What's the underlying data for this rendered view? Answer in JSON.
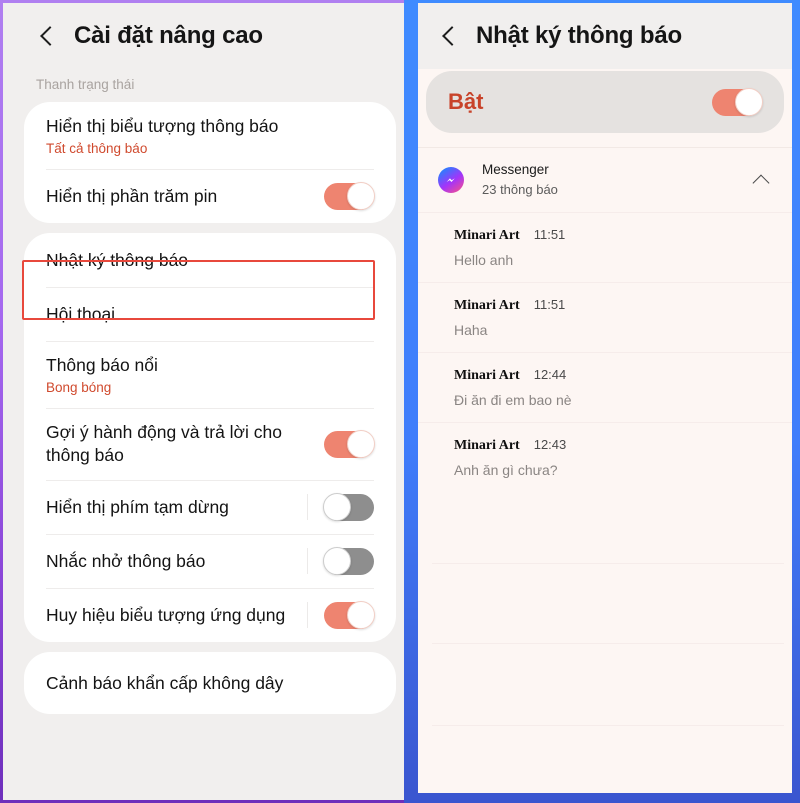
{
  "left_screen": {
    "header": {
      "back_icon": "back-chevron-icon",
      "title": "Cài đặt nâng cao"
    },
    "section_label": "Thanh trạng thái",
    "groups": [
      {
        "rows": [
          {
            "title": "Hiển thị biểu tượng thông báo",
            "subtitle": "Tất cả thông báo",
            "toggle": null
          },
          {
            "title": "Hiển thị phần trăm pin",
            "subtitle": "",
            "toggle": "on"
          }
        ]
      },
      {
        "rows": [
          {
            "title": "Nhật ký thông báo",
            "subtitle": "",
            "toggle": null,
            "highlighted": true
          },
          {
            "title": "Hội thoại",
            "subtitle": "",
            "toggle": null
          },
          {
            "title": "Thông báo nổi",
            "subtitle": "Bong bóng",
            "toggle": null
          },
          {
            "title": "Gợi ý hành động và trả lời cho thông báo",
            "subtitle": "",
            "toggle": "on"
          },
          {
            "title": "Hiển thị phím tạm dừng",
            "subtitle": "",
            "toggle": "off"
          },
          {
            "title": "Nhắc nhở thông báo",
            "subtitle": "",
            "toggle": "off"
          },
          {
            "title": "Huy hiệu biểu tượng ứng dụng",
            "subtitle": "",
            "toggle": "on"
          }
        ]
      },
      {
        "rows": [
          {
            "title": "Cảnh báo khẩn cấp không dây",
            "subtitle": "",
            "toggle": null
          }
        ]
      }
    ]
  },
  "right_screen": {
    "header": {
      "back_icon": "back-chevron-icon",
      "title": "Nhật ký thông báo"
    },
    "master_switch": {
      "label": "Bật",
      "state": "on"
    },
    "app_group": {
      "icon": "messenger-icon",
      "name": "Messenger",
      "count": "23 thông báo",
      "collapse_icon": "chevron-up-icon"
    },
    "notifications": [
      {
        "sender": "Minari Art",
        "time": "11:51",
        "body": "Hello anh"
      },
      {
        "sender": "Minari Art",
        "time": "11:51",
        "body": "Haha"
      },
      {
        "sender": "Minari Art",
        "time": "12:44",
        "body": "Đi ăn đi em bao nè"
      },
      {
        "sender": "Minari Art",
        "time": "12:43",
        "body": "Anh ăn gì chưa?"
      }
    ]
  },
  "colors": {
    "left_border": "#a568ef",
    "right_border": "#3f8bff",
    "highlight_red": "#e8483c",
    "toggle_on": "#ee8470",
    "toggle_off": "#8e8e8e",
    "accent_text": "#d04a2e"
  }
}
